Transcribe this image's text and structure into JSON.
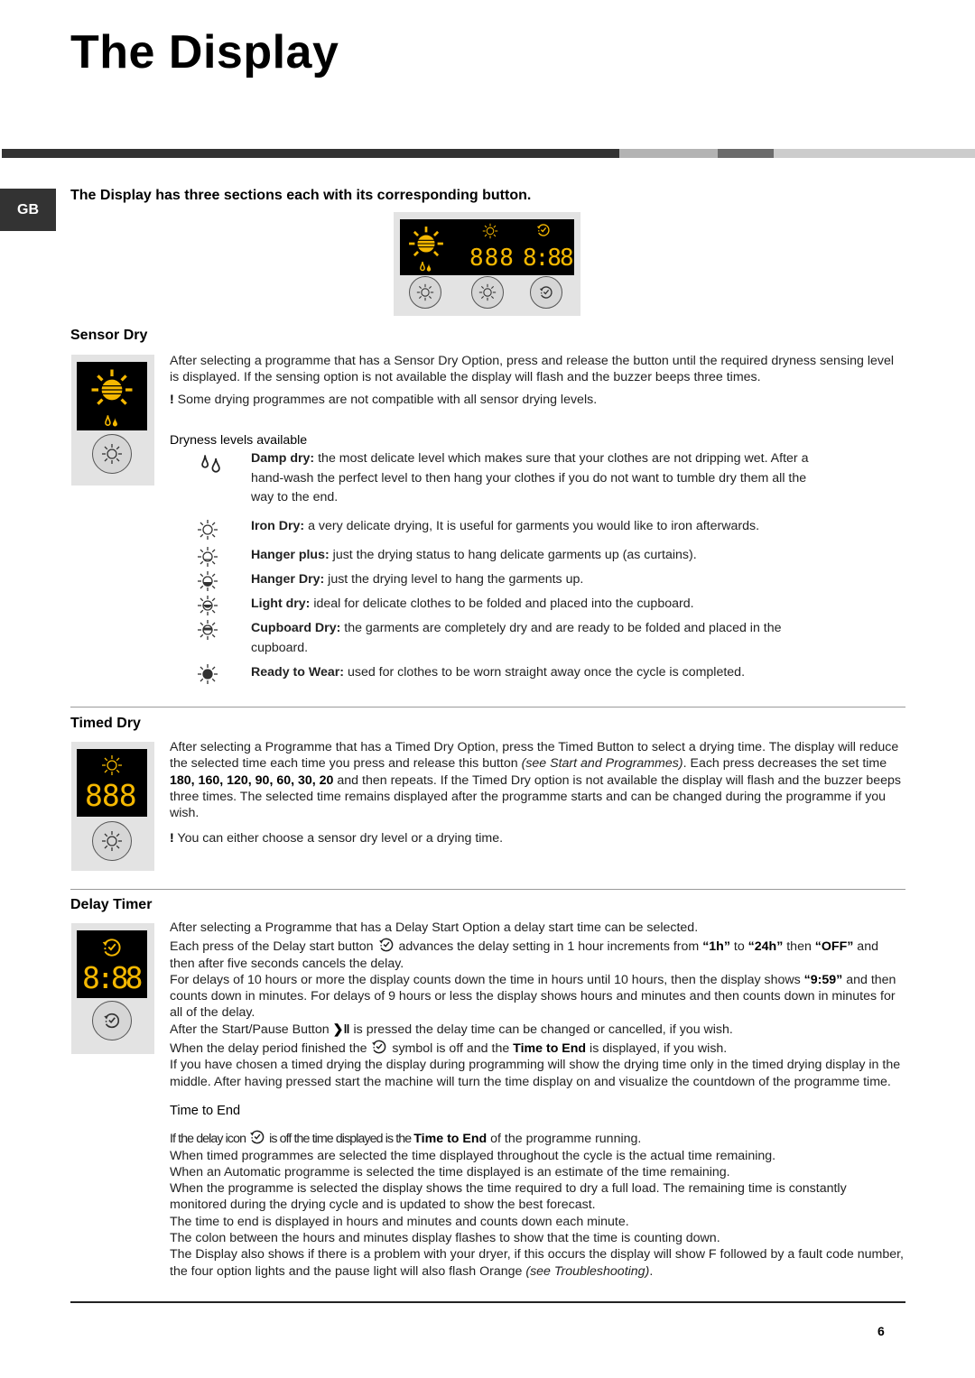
{
  "page": {
    "title": "The Display",
    "language_tab": "GB",
    "intro": "The Display has three sections each with its corresponding button.",
    "page_number": "6",
    "band_colors": [
      "#333333",
      "#b3b3b3",
      "#6b6b6b",
      "#cccccc"
    ],
    "display_color": "#f5b800"
  },
  "panel": {
    "timed_digits": "888",
    "delay_digits": "8:88",
    "buttons": [
      "sensor-dry-button",
      "timed-dry-button",
      "delay-timer-button"
    ]
  },
  "sensor_dry": {
    "heading": "Sensor Dry",
    "para1": "After selecting a programme that has a Sensor Dry Option, press and release the button until the required dryness sensing level is displayed. If the sensing option is not available the display will flash and the buzzer beeps three times.",
    "note_mark": "!",
    "note": " Some drying programmes are not compatible with all sensor drying levels.",
    "levels_title": "Dryness levels available",
    "levels": [
      {
        "icon": "damp-dry-icon",
        "name": "Damp dry:",
        "desc": " the most delicate level which makes sure that your clothes are not dripping wet. After a hand-wash the perfect level to then hang your clothes if you do not want to tumble dry them all the way to the end."
      },
      {
        "icon": "iron-dry-icon",
        "name": "Iron Dry:",
        "desc": " a very delicate drying, It is useful for garments you would like to iron afterwards."
      },
      {
        "icon": "hanger-plus-icon",
        "name": "Hanger plus:",
        "desc": " just the drying status to hang delicate garments up (as curtains)."
      },
      {
        "icon": "hanger-dry-icon",
        "name": "Hanger Dry:",
        "desc": " just the drying level to hang the garments up."
      },
      {
        "icon": "light-dry-icon",
        "name": "Light dry:",
        "desc": " ideal for delicate clothes to be folded and placed into the cupboard."
      },
      {
        "icon": "cupboard-dry-icon",
        "name": "Cupboard Dry:",
        "desc": " the garments are completely dry and are ready to be folded and placed in the cupboard."
      },
      {
        "icon": "ready-to-wear-icon",
        "name": "Ready to Wear:",
        "desc": " used for clothes to be worn straight away once the cycle is completed."
      }
    ]
  },
  "timed_dry": {
    "heading": "Timed Dry",
    "digits": "888",
    "p1_a": "After selecting a Programme that has a Timed Dry Option, press the Timed Button to select a drying time. The display will reduce the selected time each time you press and release this button ",
    "p1_ref": "(see Start and Programmes)",
    "p1_b": ". Each press decreases the set time ",
    "times": "180, 160, 120, 90, 60, 30, 20",
    "p1_c": " and then repeats. If the Timed Dry option is not available the display will flash and the buzzer beeps three times. The selected time remains displayed after the programme starts and can be changed during the programme if you wish.",
    "note_mark": "!",
    "note": " You can either choose a sensor dry level or a drying time."
  },
  "delay_timer": {
    "heading": "Delay Timer",
    "digits": "8:88",
    "l1": "After selecting a Programme that has a Delay Start Option a delay start time can be selected.",
    "l2_a": "Each press of the Delay start button ",
    "l2_b": " advances the delay setting in 1 hour increments from ",
    "from": "“1h”",
    "to_word": " to ",
    "to": "“24h”",
    "l2_c": " then ",
    "off": "“OFF”",
    "l2_d": " and then after five seconds cancels the delay.",
    "l3_a": "For delays of 10 hours or more the display counts down the time in hours until 10 hours, then the display shows ",
    "l3_val": "“9:59”",
    "l3_b": " and then counts down in minutes. For delays of 9 hours or less the display shows hours and minutes and then counts down in minutes for all of the delay.",
    "l4_a": "After the Start/Pause Button ",
    "start_pause_glyph": "❯‖",
    "l4_b": " is pressed the delay time can be changed or cancelled, if you wish.",
    "l5_a": "When the delay period finished the ",
    "l5_b": " symbol is off and the ",
    "l5_bold": "Time to End",
    "l5_c": " is displayed, if you wish.",
    "l6": "If you have chosen a timed drying the display during programming will show the drying time only in the timed drying display in the middle. After having pressed start the machine will turn the time display on and visualize the countdown of the programme time."
  },
  "time_to_end": {
    "title": "Time to End",
    "l1_a": "If the delay icon ",
    "l1_b": " is off the time displayed is the ",
    "l1_bold": "Time to End",
    "l1_c": " of the programme running.",
    "l2": "When timed programmes are selected the time displayed throughout the cycle is the actual time remaining.",
    "l3": "When an Automatic programme is selected the time displayed is an estimate of the time remaining.",
    "l4": "When the programme is selected the display shows the time required to dry a full load. The remaining time is constantly monitored during the drying cycle and is updated to show the best forecast.",
    "l5": "The time to end is displayed in hours and minutes and counts down each minute.",
    "l6": "The colon between the hours and minutes display flashes to show that the time is counting down.",
    "l7_a": "The Display also shows if there is a problem with your dryer, if this occurs the display will show F followed by a fault code number, the four option lights and the pause light will also flash Orange ",
    "l7_ref": "(see Troubleshooting)",
    "l7_b": "."
  }
}
